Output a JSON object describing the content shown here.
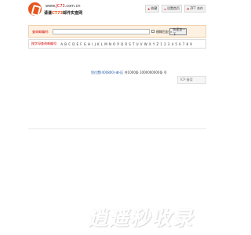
{
  "header": {
    "logo_url": "www.",
    "logo_url_hl": "JC73",
    "logo_url_tail": ".com.cn",
    "logo_name": "请谨",
    "logo_name_hl": "CT73",
    "logo_name_tail": "邮件实查网",
    "nav": [
      {
        "icon": "star-icon",
        "label": "收藏"
      },
      {
        "icon": "home-icon",
        "label": "设置首页"
      },
      {
        "icon": "mail-icon",
        "label": "ZFT 合作"
      }
    ]
  },
  "search": {
    "label": "查询邮编时:",
    "value": "",
    "checkbox_label": "模糊匹配",
    "button_label": "快速查一下"
  },
  "letters": {
    "label": "按字母查询邮编号:",
    "items": [
      "A",
      "B",
      "C",
      "D",
      "E",
      "F",
      "G",
      "H",
      "I",
      "J",
      "K",
      "L",
      "M",
      "N",
      "O",
      "P",
      "Q",
      "R",
      "S",
      "T",
      "U",
      "V",
      "W",
      "X",
      "Y",
      "Z",
      "1",
      "2",
      "3",
      "4",
      "5",
      "6",
      "7",
      "8",
      "9"
    ]
  },
  "content": {
    "link": "您位置(400800)-邮-区",
    "count": "共1000条  1000000000条 号"
  },
  "sidebar": {
    "tag": "ICP  备案"
  },
  "watermark": {
    "text": "逍遥秒收录"
  }
}
